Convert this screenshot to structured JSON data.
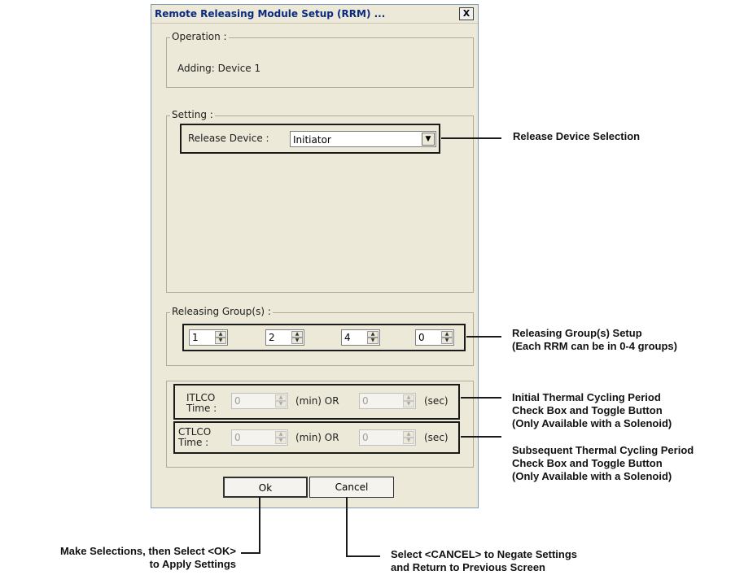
{
  "dialog": {
    "title": "Remote Releasing Module Setup (RRM) ...",
    "close_label": "X"
  },
  "operation": {
    "group_label": "Operation :",
    "text": "Adding: Device 1"
  },
  "setting": {
    "group_label": "Setting :",
    "release_device_label": "Release Device :",
    "release_device_value": "Initiator"
  },
  "releasing_groups": {
    "group_label": "Releasing Group(s) :",
    "values": [
      "1",
      "2",
      "4",
      "0"
    ]
  },
  "thermal": {
    "itlco_label": "ITLCO\nTime :",
    "itlco_label_line1": "ITLCO",
    "itlco_label_line2": "Time :",
    "itlco_min": "0",
    "itlco_sec": "0",
    "ctlco_label_line1": "CTLCO",
    "ctlco_label_line2": "Time :",
    "ctlco_min": "0",
    "ctlco_sec": "0",
    "min_or_label": "(min) OR",
    "sec_label": "(sec)"
  },
  "buttons": {
    "ok_label": "Ok",
    "cancel_label": "Cancel"
  },
  "annotations": {
    "release_device": "Release Device Selection",
    "groups_line1": "Releasing Group(s) Setup",
    "groups_line2": "(Each RRM can be in 0-4 groups)",
    "initial_line1": "Initial Thermal Cycling Period",
    "initial_line2": "Check Box and Toggle Button",
    "initial_line3": "(Only Available with a Solenoid)",
    "subsequent_line1": "Subsequent Thermal Cycling Period",
    "subsequent_line2": "Check Box and Toggle Button",
    "subsequent_line3": "(Only Available with a Solenoid)",
    "ok_line1": "Make Selections, then Select <OK>",
    "ok_line2": "to Apply Settings",
    "cancel_line1": "Select <CANCEL> to Negate Settings",
    "cancel_line2": "and Return to Previous Screen"
  }
}
